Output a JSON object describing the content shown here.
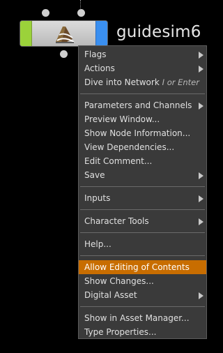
{
  "node": {
    "name": "guidesim6",
    "icon": "character-sim-icon",
    "colors": {
      "left_flag": "#9bd23a",
      "right_flag": "#3a8ff0",
      "body": "#c8c8c8"
    }
  },
  "menu": {
    "groups": [
      [
        {
          "label": "Flags",
          "submenu": true
        },
        {
          "label": "Actions",
          "submenu": true
        },
        {
          "label": "Dive into Network",
          "shortcut": "I or Enter"
        }
      ],
      [
        {
          "label": "Parameters and Channels",
          "submenu": true
        },
        {
          "label": "Preview Window..."
        },
        {
          "label": "Show Node Information..."
        },
        {
          "label": "View Dependencies..."
        },
        {
          "label": "Edit Comment..."
        },
        {
          "label": "Save",
          "submenu": true
        }
      ],
      [
        {
          "label": "Inputs",
          "submenu": true
        }
      ],
      [
        {
          "label": "Character Tools",
          "submenu": true
        }
      ],
      [
        {
          "label": "Help..."
        }
      ],
      [
        {
          "label": "Allow Editing of Contents",
          "highlighted": true
        },
        {
          "label": "Show Changes..."
        },
        {
          "label": "Digital Asset",
          "submenu": true
        }
      ],
      [
        {
          "label": "Show in Asset Manager..."
        },
        {
          "label": "Type Properties..."
        }
      ]
    ],
    "highlight_color": "#c86d00"
  }
}
